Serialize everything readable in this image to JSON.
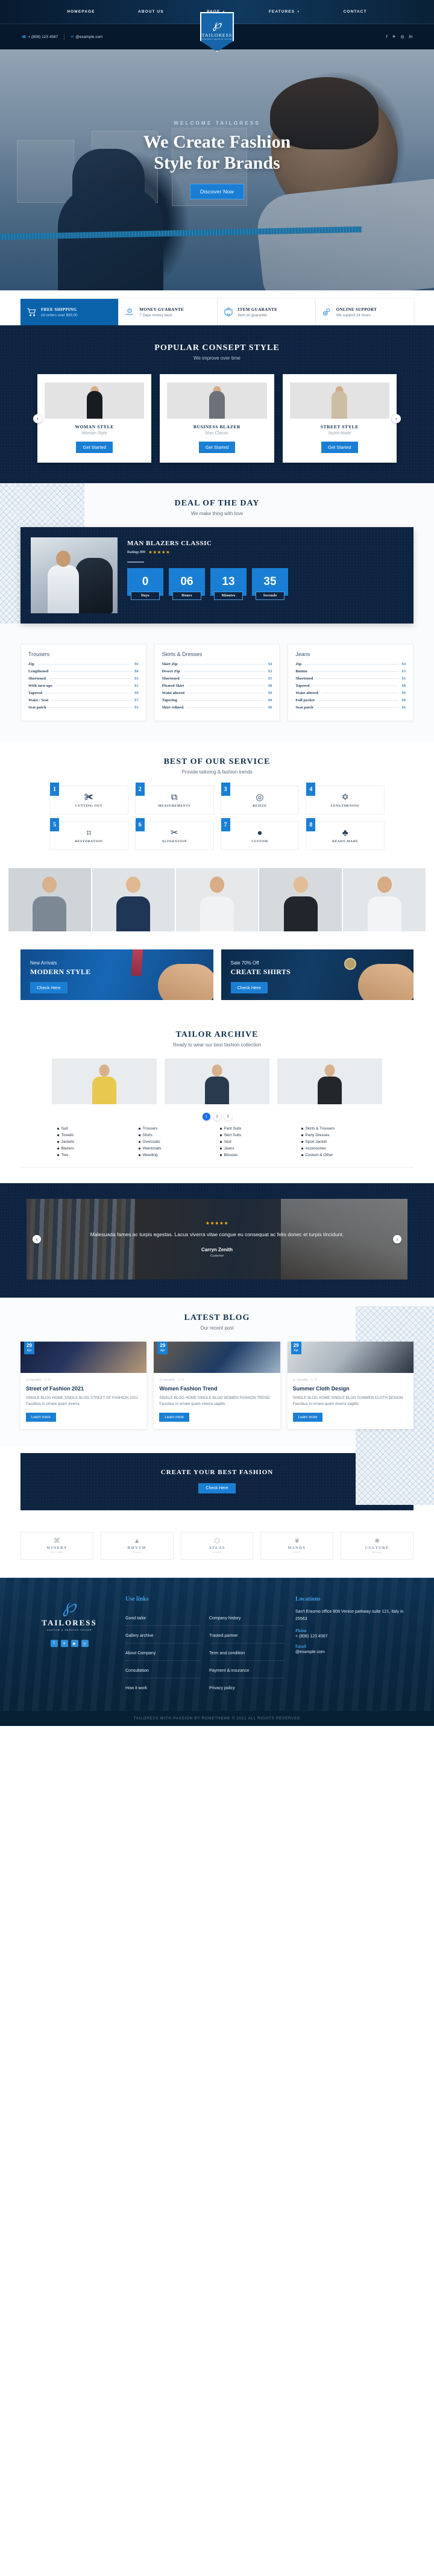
{
  "header": {
    "nav": [
      {
        "label": "HOMEPAGE",
        "caret": false
      },
      {
        "label": "ABOUT US",
        "caret": false
      },
      {
        "label": "PAGE",
        "caret": true
      },
      {
        "label": "FEATURES",
        "caret": true
      },
      {
        "label": "CONTACT",
        "caret": false
      }
    ],
    "phone": "+ (808) 123 4567",
    "email": "@example.com",
    "socials": [
      "f",
      "✈",
      "◎",
      "in"
    ],
    "logo": {
      "mark": "℘",
      "name": "TAILORESS",
      "tagline": "CUSTOM & SERVICE TAILOR"
    }
  },
  "hero": {
    "welcome": "WELCOME TAILORESS",
    "title_line1": "We Create Fashion",
    "title_line2": "Style for Brands",
    "cta": "Discover Now"
  },
  "services_strip": [
    {
      "icon": "shopping-cart-icon",
      "title": "FREE SHIPPING",
      "desc": "All orders over $99.00",
      "active": true
    },
    {
      "icon": "money-hand-icon",
      "title": "MONEY GUARANTE",
      "desc": "7 Days money back",
      "active": false
    },
    {
      "icon": "box-cube-icon",
      "title": "ITEM GUARANTE",
      "desc": "Item on guarantte",
      "active": false
    },
    {
      "icon": "gears-icon",
      "title": "ONLINE SUPPORT",
      "desc": "We support 24 hours",
      "active": false
    }
  ],
  "concept": {
    "title": "POPULAR CONSEPT STYLE",
    "subtitle": "We improve over time",
    "cards": [
      {
        "name": "WOMAN STYLE",
        "sub": "Woman Style",
        "cta": "Get Started",
        "color": "#181c22"
      },
      {
        "name": "BUSINESS BLAZER",
        "sub": "Man Classic",
        "cta": "Get Started",
        "color": "#6d717a"
      },
      {
        "name": "STREET STYLE",
        "sub": "Stylist Mode",
        "cta": "Get Started",
        "color": "#cdbda2"
      }
    ],
    "prev": "‹",
    "next": "›"
  },
  "deal": {
    "title": "DEAL OF THE DAY",
    "subtitle": "We make thing with love",
    "product": "MAN BLAZERS CLASSIC",
    "ratings_label": "Ratings 899",
    "stars": "★★★★★",
    "countdown": [
      {
        "value": "0",
        "label": "Days"
      },
      {
        "value": "06",
        "label": "Hours"
      },
      {
        "value": "13",
        "label": "Minutes"
      },
      {
        "value": "35",
        "label": "Seconds"
      }
    ]
  },
  "price_lists": [
    {
      "title": "Trousers",
      "items": [
        {
          "name": "Zip",
          "price": "$6"
        },
        {
          "name": "Lengthened",
          "price": "$8"
        },
        {
          "name": "Shortened",
          "price": "$3"
        },
        {
          "name": "With turn ups",
          "price": "$1"
        },
        {
          "name": "Tapered",
          "price": "$9"
        },
        {
          "name": "Waist / Seat",
          "price": "$7"
        },
        {
          "name": "Seat patch",
          "price": "$5"
        }
      ]
    },
    {
      "title": "Skirts & Dresses",
      "items": [
        {
          "name": "Skirt Zip",
          "price": "$4"
        },
        {
          "name": "Desert Zip",
          "price": "$3"
        },
        {
          "name": "Shortened",
          "price": "$5"
        },
        {
          "name": "Pleated Skirt",
          "price": "$8"
        },
        {
          "name": "Waist altered",
          "price": "$9"
        },
        {
          "name": "Tapering",
          "price": "$8"
        },
        {
          "name": "Skirt relined",
          "price": "$6"
        }
      ]
    },
    {
      "title": "Jeans",
      "items": [
        {
          "name": "Zip",
          "price": "$4"
        },
        {
          "name": "Button",
          "price": "$3"
        },
        {
          "name": "Shortened",
          "price": "$5"
        },
        {
          "name": "Tapered",
          "price": "$8"
        },
        {
          "name": "Waist altered",
          "price": "$9"
        },
        {
          "name": "Full pocket",
          "price": "$8"
        },
        {
          "name": "Seat patch",
          "price": "$6"
        }
      ]
    }
  ],
  "best_service": {
    "title": "BEST OF OUR SERVICE",
    "subtitle": "Provide tailoring & fashion trends",
    "items": [
      {
        "num": "1",
        "label": "CUTTING OUT",
        "icon": "scissors-cloth-icon",
        "glyph": "✀"
      },
      {
        "num": "2",
        "label": "MEASUREMENTS",
        "icon": "tape-measure-icon",
        "glyph": "⧉"
      },
      {
        "num": "3",
        "label": "RESIZE",
        "icon": "yarn-ball-icon",
        "glyph": "◎"
      },
      {
        "num": "4",
        "label": "LENGTHENING",
        "icon": "needle-thread-icon",
        "glyph": "✡"
      },
      {
        "num": "5",
        "label": "RESTORATION",
        "icon": "sewing-machine-icon",
        "glyph": "⌗"
      },
      {
        "num": "6",
        "label": "ALTERATION",
        "icon": "scissors-icon",
        "glyph": "✂"
      },
      {
        "num": "7",
        "label": "CUSTOM",
        "icon": "buttons-icon",
        "glyph": "●"
      },
      {
        "num": "8",
        "label": "READY MADE",
        "icon": "mannequin-icon",
        "glyph": "♣"
      }
    ]
  },
  "gallery": [
    {
      "name": "gallery-photo-1",
      "bg": "#cfd4d8",
      "body": "#7c8893",
      "head": "#d8b28f"
    },
    {
      "name": "gallery-photo-2",
      "bg": "#dfe3e6",
      "body": "#1f3555",
      "head": "#e0b892"
    },
    {
      "name": "gallery-photo-3",
      "bg": "#e6e8ea",
      "body": "#f0f2f4",
      "head": "#d9ad86"
    },
    {
      "name": "gallery-photo-4",
      "bg": "#d6dadd",
      "body": "#22262c",
      "head": "#e2be96"
    },
    {
      "name": "gallery-photo-5",
      "bg": "#e3e6e8",
      "body": "#f3f4f6",
      "head": "#d7ab84"
    }
  ],
  "promos": [
    {
      "kicker": "New Arrivals",
      "title": "MODERN STYLE",
      "cta": "Check Here"
    },
    {
      "kicker": "Sale 70% Off",
      "title": "CREATE SHIRTS",
      "cta": "Check Here"
    }
  ],
  "archive": {
    "title": "TAILOR ARCHIVE",
    "subtitle": "Ready to wear our best fashion collection",
    "cards": [
      {
        "name": "archive-photo-1",
        "body": "#e8c84f"
      },
      {
        "name": "archive-photo-2",
        "body": "#2a3a4e"
      },
      {
        "name": "archive-photo-3",
        "body": "#23262b"
      }
    ],
    "pages": [
      "1",
      "2",
      "3"
    ],
    "active_page": "1",
    "tag_columns": [
      [
        "Suit",
        "Toxedo",
        "Jackets",
        "Blazers",
        "Ties"
      ],
      [
        "Trousers",
        "Shirts",
        "Overcoats",
        "Waistcoats",
        "Weeding"
      ],
      [
        "Pant Suits",
        "Skirt Suits",
        "Vest",
        "Jeans",
        "Blouses"
      ],
      [
        "Skirts & Trousers",
        "Party Dresses",
        "Sport Jacket",
        "Accessories",
        "Costum & Other"
      ]
    ]
  },
  "testimonial": {
    "stars": "★★★★★",
    "quote": "Malesuada fames ac turpis egestas. Lacus viverra vitae congue eu consequat ac felis donec et turpis tincidunt.",
    "author": "Carryn Zenith",
    "role": "Customer",
    "prev": "‹",
    "next": "›"
  },
  "blog": {
    "title": "LATEST BLOG",
    "subtitle": "Our recent post",
    "posts": [
      {
        "day": "29",
        "month": "Apr",
        "author": "hendrik",
        "comments": "0",
        "title": "Street of Fashion 2021",
        "excerpt": "SINGLE BLOG HOME SINGLE BLOG STREET OF FASHION 2021 Faucibus in ornare quam viverra",
        "cta": "Learn more"
      },
      {
        "day": "29",
        "month": "Apr",
        "author": "hendrik",
        "comments": "0",
        "title": "Women Fashion Trend",
        "excerpt": "SINGLE BLOG HOME SINGLE BLOG WOMEN FASHION TREND Faucibus in ornare quam viverra sagittis",
        "cta": "Learn more"
      },
      {
        "day": "29",
        "month": "Apr",
        "author": "hendrik",
        "comments": "0",
        "title": "Summer Cloth Design",
        "excerpt": "SINGLE BLOG HOME SINGLE BLOG SUMMER CLOTH DESIGN Faucibus in ornare quam viverra sagittis",
        "cta": "Learn more"
      }
    ]
  },
  "cta": {
    "title": "CREATE YOUR BEST FASHION",
    "button": "Check Here"
  },
  "brands": [
    {
      "name": "WINERY",
      "sub": "EST 1985",
      "glyph": "⌘"
    },
    {
      "name": "RHYTM",
      "sub": "STUDIO",
      "glyph": "▲"
    },
    {
      "name": "ATLAS",
      "sub": "HOUSE",
      "glyph": "⬡"
    },
    {
      "name": "HANDY",
      "sub": "CRAFT",
      "glyph": "❦"
    },
    {
      "name": "CULTURE",
      "sub": "BRAND",
      "glyph": "❀"
    }
  ],
  "footer": {
    "logo": {
      "mark": "℘",
      "name": "TAILORESS",
      "tagline": "CUSTOM & SERVICE TAILOR"
    },
    "socials": [
      "f",
      "✈",
      "▶",
      "ⓟ"
    ],
    "links_heading": "Use links",
    "links_col1": [
      "Good tailor",
      "Gallery archive",
      "About Company",
      "Consultation",
      "How it work"
    ],
    "links_col2": [
      "Company history",
      "Trasted partner",
      "Term and condition",
      "Payment & insurance",
      "Privacy policy"
    ],
    "locations_heading": "Locations",
    "address": "San't Erasmo office 808 Venice parkway suite 121, Italy in 25563",
    "phone_label": "Phone",
    "phone": "+ (808) 123 4567",
    "email_label": "Email",
    "email": "@example.com",
    "copyright": "TAILORESS WITH PASSION BY ROMETHEME © 2021 ALL RIGHTS RESERVED"
  }
}
